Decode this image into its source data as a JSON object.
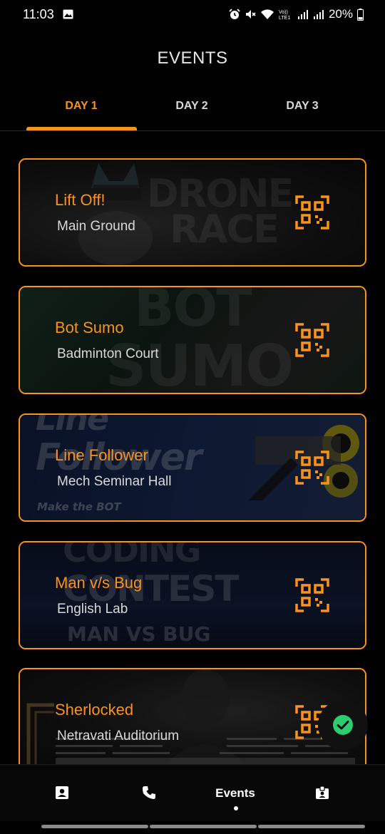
{
  "status_bar": {
    "time": "11:03",
    "battery": "20%",
    "icons": [
      "image-icon",
      "alarm-icon",
      "mute-icon",
      "wifi-icon",
      "volte-icon",
      "signal-icon",
      "signal-icon",
      "battery-icon"
    ]
  },
  "header": {
    "title": "EVENTS"
  },
  "tabs": [
    {
      "label": "DAY 1",
      "active": true
    },
    {
      "label": "DAY 2",
      "active": false
    },
    {
      "label": "DAY 3",
      "active": false
    }
  ],
  "events": [
    {
      "name": "Lift Off!",
      "venue": "Main Ground"
    },
    {
      "name": "Bot Sumo",
      "venue": "Badminton Court"
    },
    {
      "name": "Line Follower",
      "venue": "Mech Seminar Hall"
    },
    {
      "name": "Man v/s Bug",
      "venue": "English Lab"
    },
    {
      "name": "Sherlocked",
      "venue": "Netravati Auditorium"
    }
  ],
  "poster_text": {
    "drone": "DRONE",
    "race": "RACE",
    "bot": "BOT",
    "sumo": "SUMO",
    "line": "Line",
    "follower": "Follower",
    "make_bot": "Make the BOT",
    "coding": "CODING",
    "contest": "CONTEST",
    "man_vs_bug": "MAN VS BUG"
  },
  "bottom_nav": {
    "items": [
      {
        "icon": "contact-card-icon"
      },
      {
        "icon": "phone-icon"
      },
      {
        "label": "Events",
        "active": true
      },
      {
        "icon": "id-badge-icon"
      }
    ]
  },
  "colors": {
    "accent": "#f7931e",
    "background": "#000000",
    "check": "#2ecc71"
  }
}
